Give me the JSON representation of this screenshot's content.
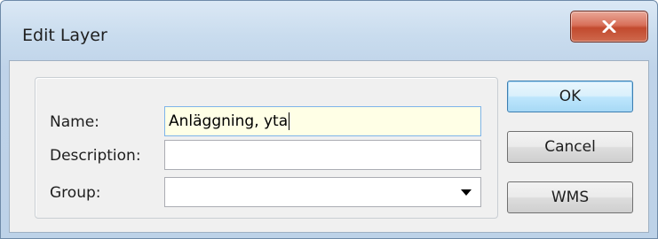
{
  "window": {
    "title": "Edit Layer"
  },
  "form": {
    "name": {
      "label": "Name:",
      "value": "Anläggning, yta"
    },
    "description": {
      "label": "Description:",
      "value": ""
    },
    "group": {
      "label": "Group:",
      "value": ""
    }
  },
  "buttons": {
    "ok": "OK",
    "cancel": "Cancel",
    "wms": "WMS"
  },
  "icons": {
    "close": "close-icon",
    "dropdown": "chevron-down-icon"
  },
  "colors": {
    "close_button": "#c24a2e",
    "focused_field": "#ffffe6"
  }
}
